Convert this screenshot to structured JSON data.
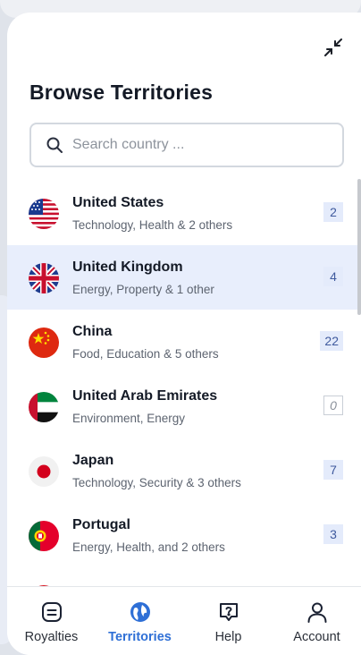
{
  "sheet": {
    "title": "Browse Territories",
    "collapse_icon": "collapse-arrows-icon"
  },
  "search": {
    "placeholder": "Search country ...",
    "value": ""
  },
  "territories": [
    {
      "name": "United States",
      "sectors": "Technology, Health & 2 others",
      "count": "2",
      "flag": "us-flag-icon",
      "selected": false
    },
    {
      "name": "United Kingdom",
      "sectors": "Energy, Property & 1 other",
      "count": "4",
      "flag": "uk-flag-icon",
      "selected": true
    },
    {
      "name": "China",
      "sectors": "Food, Education & 5 others",
      "count": "22",
      "flag": "china-flag-icon",
      "selected": false
    },
    {
      "name": "United Arab Emirates",
      "sectors": "Environment, Energy",
      "count": "0",
      "flag": "uae-flag-icon",
      "selected": false
    },
    {
      "name": "Japan",
      "sectors": "Technology, Security & 3 others",
      "count": "7",
      "flag": "japan-flag-icon",
      "selected": false
    },
    {
      "name": "Portugal",
      "sectors": "Energy, Health, and 2 others",
      "count": "3",
      "flag": "portugal-flag-icon",
      "selected": false
    }
  ],
  "nav": {
    "items": [
      {
        "label": "Royalties",
        "icon": "royalties-icon",
        "active": false
      },
      {
        "label": "Territories",
        "icon": "globe-icon",
        "active": true
      },
      {
        "label": "Help",
        "icon": "help-icon",
        "active": false
      },
      {
        "label": "Account",
        "icon": "account-icon",
        "active": false
      }
    ]
  },
  "colors": {
    "accent": "#2e6fd6",
    "selected_row": "#e8eefc",
    "badge_bg": "#e4ebfb",
    "badge_text": "#3f5a9e"
  }
}
